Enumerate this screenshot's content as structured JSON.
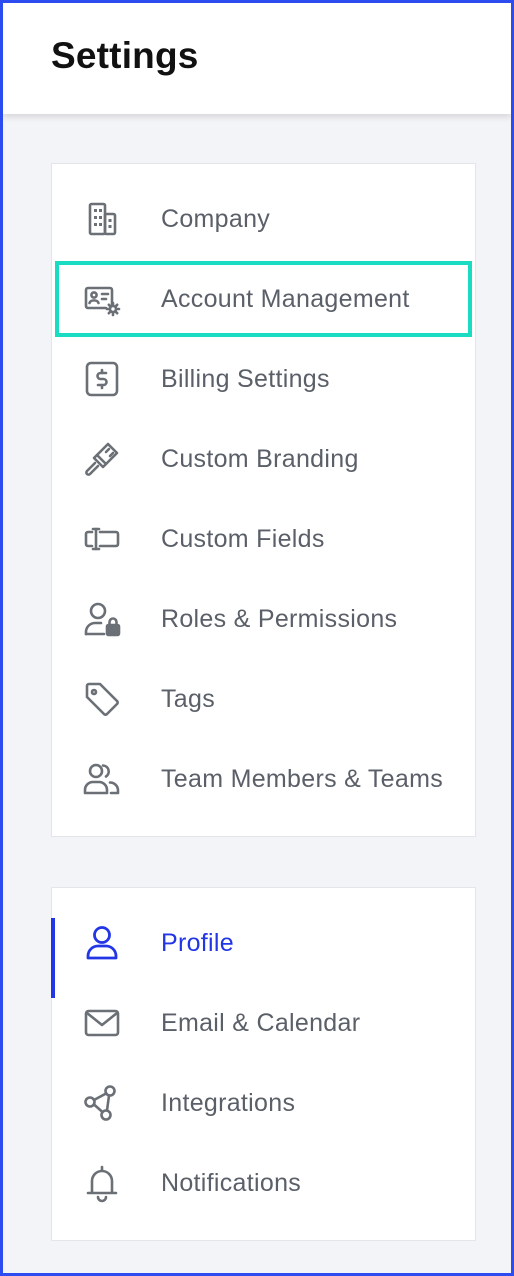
{
  "header": {
    "title": "Settings"
  },
  "org_section": {
    "items": [
      {
        "label": "Company",
        "icon": "building-icon"
      },
      {
        "label": "Account Management",
        "icon": "id-card-gear-icon",
        "highlighted": true
      },
      {
        "label": "Billing Settings",
        "icon": "dollar-square-icon"
      },
      {
        "label": "Custom Branding",
        "icon": "paintbrush-icon"
      },
      {
        "label": "Custom Fields",
        "icon": "text-field-icon"
      },
      {
        "label": "Roles & Permissions",
        "icon": "user-lock-icon"
      },
      {
        "label": "Tags",
        "icon": "tag-icon"
      },
      {
        "label": "Team Members & Teams",
        "icon": "users-icon"
      }
    ]
  },
  "personal_section": {
    "items": [
      {
        "label": "Profile",
        "icon": "user-icon",
        "active": true
      },
      {
        "label": "Email & Calendar",
        "icon": "envelope-icon"
      },
      {
        "label": "Integrations",
        "icon": "share-nodes-icon"
      },
      {
        "label": "Notifications",
        "icon": "bell-icon"
      }
    ]
  },
  "colors": {
    "accent": "#2336e6",
    "highlight": "#19dcc2",
    "frame_border": "#2d4cf0",
    "text": "#5a5f68",
    "background": "#f3f4f7"
  }
}
